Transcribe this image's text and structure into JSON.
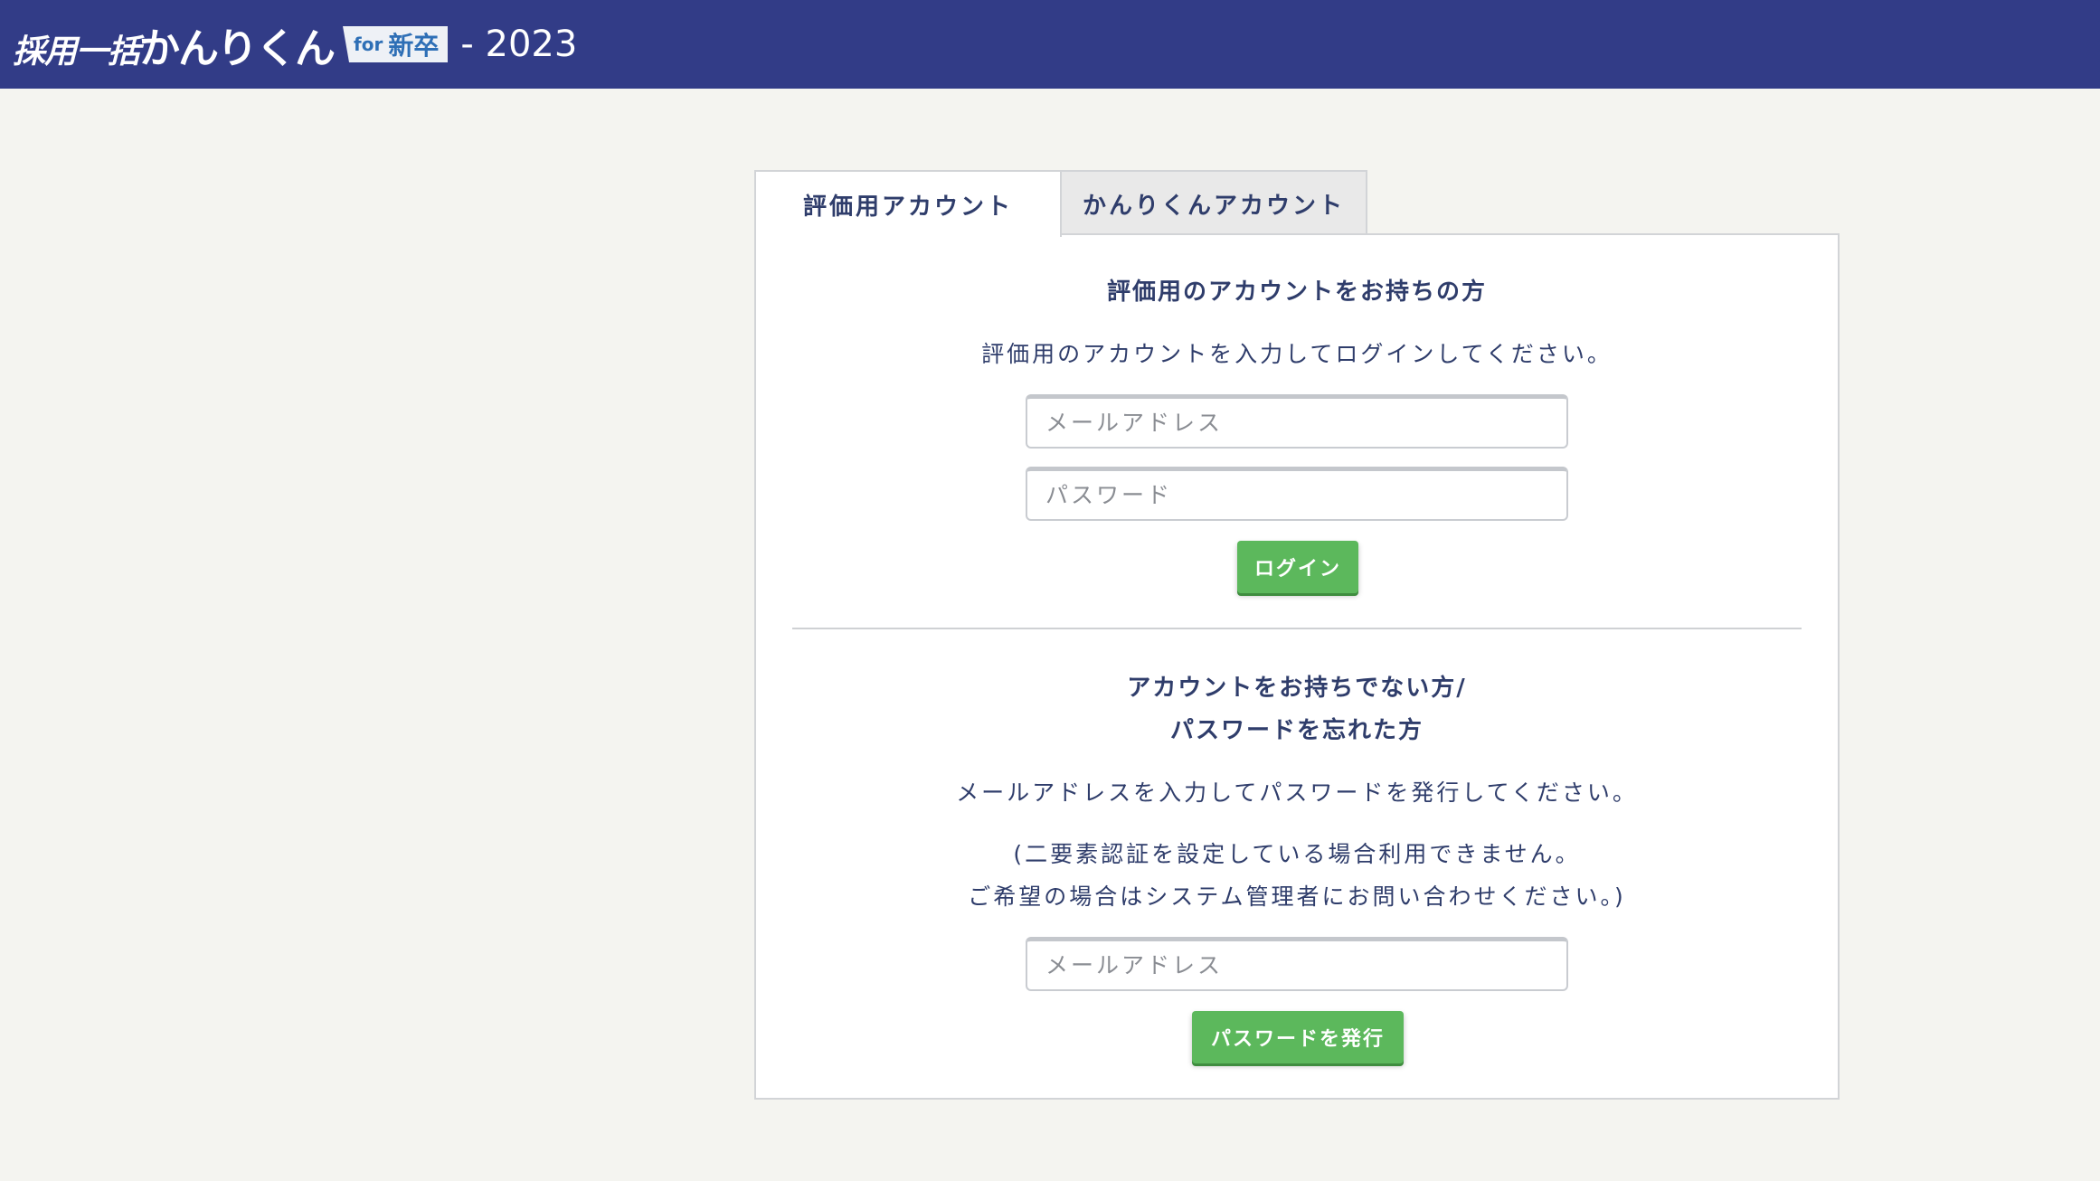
{
  "header": {
    "logo_main": "採用一括",
    "logo_big": "かんりくん",
    "logo_for": "for",
    "logo_kind": "新卒",
    "year_text": "- 2023",
    "background_color": "#323c87"
  },
  "tabs": [
    {
      "label": "評価用アカウント",
      "active": true
    },
    {
      "label": "かんりくんアカウント",
      "active": false
    }
  ],
  "login_section": {
    "title": "評価用のアカウントをお持ちの方",
    "description": "評価用のアカウントを入力してログインしてください。",
    "email_placeholder": "メールアドレス",
    "email_value": "",
    "password_placeholder": "パスワード",
    "password_value": "",
    "login_button": "ログイン"
  },
  "reset_section": {
    "title_line1": "アカウントをお持ちでない方/",
    "title_line2": "パスワードを忘れた方",
    "description": "メールアドレスを入力してパスワードを発行してください。",
    "note_line1": "(二要素認証を設定している場合利用できません。",
    "note_line2": "ご希望の場合はシステム管理者にお問い合わせください。)",
    "email_placeholder": "メールアドレス",
    "email_value": "",
    "issue_button": "パスワードを発行"
  },
  "colors": {
    "accent_green": "#5cb85c",
    "text_navy": "#2f3d6b",
    "page_background": "#f4f4f0"
  }
}
